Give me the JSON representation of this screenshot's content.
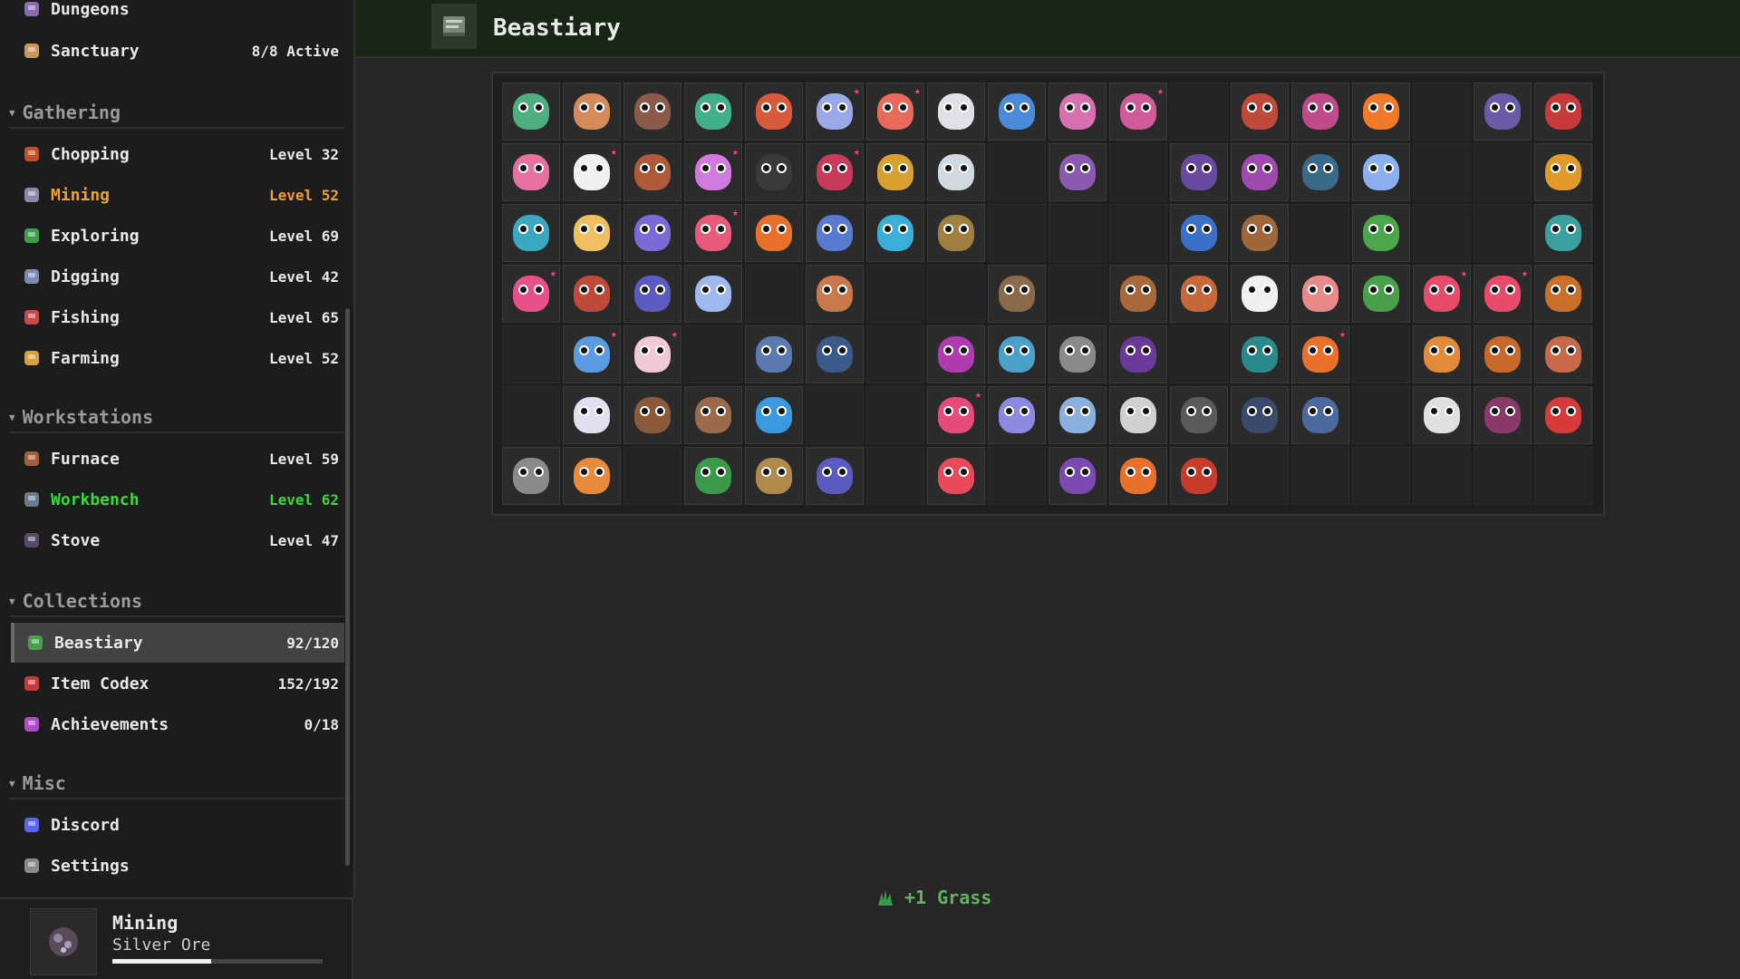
{
  "sidebar": {
    "top_items": [
      {
        "label": "Dungeons",
        "value": "",
        "icon": "dungeon-icon",
        "color": "#e8e8e8"
      },
      {
        "label": "Sanctuary",
        "value": "8/8 Active",
        "icon": "castle-icon",
        "color": "#e8e8e8"
      }
    ],
    "sections": [
      {
        "title": "Gathering",
        "items": [
          {
            "label": "Chopping",
            "value": "Level 32",
            "icon": "axe-icon",
            "color": "#e8e8e8"
          },
          {
            "label": "Mining",
            "value": "Level 52",
            "icon": "pickaxe-icon",
            "color": "#f0a030"
          },
          {
            "label": "Exploring",
            "value": "Level 69",
            "icon": "leaf-icon",
            "color": "#e8e8e8"
          },
          {
            "label": "Digging",
            "value": "Level 42",
            "icon": "shovel-icon",
            "color": "#e8e8e8"
          },
          {
            "label": "Fishing",
            "value": "Level 65",
            "icon": "fish-icon",
            "color": "#e8e8e8"
          },
          {
            "label": "Farming",
            "value": "Level 52",
            "icon": "wheat-icon",
            "color": "#e8e8e8"
          }
        ]
      },
      {
        "title": "Workstations",
        "items": [
          {
            "label": "Furnace",
            "value": "Level 59",
            "icon": "furnace-icon",
            "color": "#e8e8e8"
          },
          {
            "label": "Workbench",
            "value": "Level 62",
            "icon": "workbench-icon",
            "color": "#3ad83a"
          },
          {
            "label": "Stove",
            "value": "Level 47",
            "icon": "stove-icon",
            "color": "#e8e8e8"
          }
        ]
      },
      {
        "title": "Collections",
        "items": [
          {
            "label": "Beastiary",
            "value": "92/120",
            "icon": "book-icon",
            "color": "#e8e8e8",
            "selected": true
          },
          {
            "label": "Item Codex",
            "value": "152/192",
            "icon": "codex-icon",
            "color": "#e8e8e8"
          },
          {
            "label": "Achievements",
            "value": "0/18",
            "icon": "trophy-icon",
            "color": "#e8e8e8"
          }
        ]
      },
      {
        "title": "Misc",
        "items": [
          {
            "label": "Discord",
            "value": "",
            "icon": "discord-icon",
            "color": "#e8e8e8"
          },
          {
            "label": "Settings",
            "value": "",
            "icon": "gear-icon",
            "color": "#e8e8e8"
          }
        ]
      }
    ]
  },
  "footer": {
    "title": "Mining",
    "subtitle": "Silver Ore",
    "progress": 0.47
  },
  "header": {
    "title": "Beastiary",
    "icon": "book-icon"
  },
  "grid": {
    "columns": 18,
    "rows": 7,
    "cells": [
      [
        {
          "c": "#4fae7e"
        },
        {
          "c": "#d48a5a"
        },
        {
          "c": "#8a5a4a"
        },
        {
          "c": "#3fb08a"
        },
        {
          "c": "#d85a3a"
        },
        {
          "c": "#9aa8e8",
          "s": 1
        },
        {
          "c": "#e86a5a",
          "s": 1
        },
        {
          "c": "#e0e0e8"
        },
        {
          "c": "#4a8ad8"
        },
        {
          "c": "#d870b0"
        },
        {
          "c": "#d05a9a",
          "s": 1
        },
        null,
        {
          "c": "#c04a3a"
        },
        {
          "c": "#c04a8a"
        },
        {
          "c": "#f07a2a"
        },
        null,
        {
          "c": "#6a5aa8"
        },
        {
          "c": "#c83a3a"
        }
      ],
      [
        {
          "c": "#e870a0"
        },
        {
          "c": "#f0f0f0",
          "s": 1
        },
        {
          "c": "#b05a3a"
        },
        {
          "c": "#d07ae0",
          "s": 1
        },
        {
          "c": "#3a3a3a"
        },
        {
          "c": "#c83a5a",
          "s": 1
        },
        {
          "c": "#d8a030"
        },
        {
          "c": "#d0d8e0"
        },
        null,
        {
          "c": "#8a5ab0"
        },
        null,
        {
          "c": "#6a4aa0"
        },
        {
          "c": "#a04ab0"
        },
        {
          "c": "#3a6a8a"
        },
        {
          "c": "#8ab0f0"
        },
        null,
        null,
        {
          "c": "#e09a2a"
        }
      ],
      [
        {
          "c": "#3aa8c0"
        },
        {
          "c": "#f0c060"
        },
        {
          "c": "#7a6ad8"
        },
        {
          "c": "#e85a7a",
          "s": 1
        },
        {
          "c": "#e8702a"
        },
        {
          "c": "#5a7ad0"
        },
        {
          "c": "#3ab0d8"
        },
        {
          "c": "#a08040"
        },
        null,
        null,
        null,
        {
          "c": "#3a70c8"
        },
        {
          "c": "#a0683a"
        },
        null,
        {
          "c": "#4aa84a"
        },
        null,
        null,
        {
          "c": "#3aa0a0"
        }
      ],
      [
        {
          "c": "#e8508a",
          "s": 1
        },
        {
          "c": "#c04a3a"
        },
        {
          "c": "#5a5ac0"
        },
        {
          "c": "#a0b8f0"
        },
        null,
        {
          "c": "#c8784a"
        },
        null,
        null,
        {
          "c": "#8a6a4a"
        },
        null,
        {
          "c": "#a8683a"
        },
        {
          "c": "#c8683a"
        },
        {
          "c": "#f0f0f0"
        },
        {
          "c": "#e88a8a"
        },
        {
          "c": "#4aa04a"
        },
        {
          "c": "#e84a6a",
          "s": 1
        },
        {
          "c": "#e84a6a",
          "s": 1
        },
        {
          "c": "#c8702a"
        }
      ],
      [
        null,
        {
          "c": "#5a9ae0",
          "s": 1
        },
        {
          "c": "#f0c8d8",
          "s": 1
        },
        null,
        {
          "c": "#5a7ab0"
        },
        {
          "c": "#3a5a8a"
        },
        null,
        {
          "c": "#b03ab0"
        },
        {
          "c": "#4aa0c8"
        },
        {
          "c": "#8a8a8a"
        },
        {
          "c": "#6a3a9a"
        },
        null,
        {
          "c": "#2a8a8a"
        },
        {
          "c": "#e8702a",
          "s": 1
        },
        null,
        {
          "c": "#e08a3a"
        },
        {
          "c": "#c8682a"
        },
        {
          "c": "#c86a4a"
        }
      ],
      [
        null,
        {
          "c": "#e0e0f0"
        },
        {
          "c": "#8a5a3a"
        },
        {
          "c": "#9a6a4a"
        },
        {
          "c": "#3a9ae0"
        },
        null,
        null,
        {
          "c": "#e84a7a",
          "s": 1
        },
        {
          "c": "#8a8ae0"
        },
        {
          "c": "#8ab0e0"
        },
        {
          "c": "#d0d0d0"
        },
        {
          "c": "#5a5a5a"
        },
        {
          "c": "#3a4a6a"
        },
        {
          "c": "#4a6aa0"
        },
        null,
        {
          "c": "#e0e0e0"
        },
        {
          "c": "#8a3a6a"
        },
        {
          "c": "#d83a3a"
        }
      ],
      [
        {
          "c": "#8a8a8a"
        },
        {
          "c": "#e88a3a"
        },
        null,
        {
          "c": "#3a9a4a"
        },
        {
          "c": "#b08a4a"
        },
        {
          "c": "#5a5ac0"
        },
        null,
        {
          "c": "#e84a5a"
        },
        null,
        {
          "c": "#7a4ab0"
        },
        {
          "c": "#e8702a"
        },
        {
          "c": "#c83a2a"
        },
        null,
        null,
        null,
        null,
        null,
        null
      ]
    ]
  },
  "toast": {
    "text": "+1 Grass",
    "icon": "grass-icon"
  }
}
